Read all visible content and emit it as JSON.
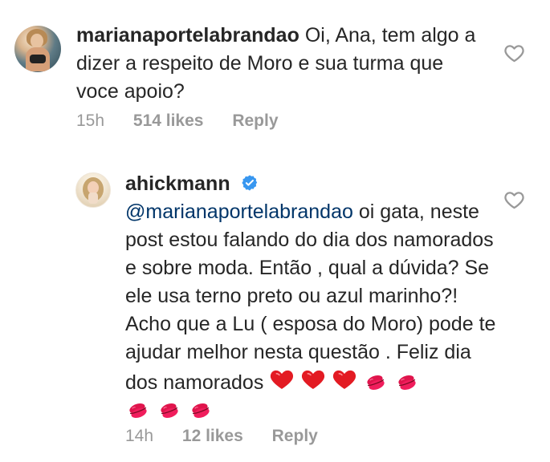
{
  "comment1": {
    "username": "marianaportelabrandao",
    "text": "Oi, Ana, tem algo a dizer a respeito de Moro e sua turma que voce apoio?",
    "time": "15h",
    "likes": "514 likes",
    "reply": "Reply"
  },
  "comment2": {
    "username": "ahickmann",
    "mention": "@marianaportelabrandao",
    "text": "oi gata, neste post estou falando do dia dos namorados e sobre moda. Então , qual a dúvida? Se ele usa terno preto ou azul marinho?! Acho que a Lu ( esposa do Moro) pode te ajudar melhor nesta questão . Feliz dia dos namorados",
    "emojis": [
      "heart",
      "heart",
      "heart",
      "kiss",
      "kiss",
      "kiss",
      "kiss",
      "kiss"
    ],
    "time": "14h",
    "likes": "12 likes",
    "reply": "Reply"
  },
  "icons": {
    "heart_outline": "heart-outline-icon",
    "verified_badge": "verified-badge-icon"
  },
  "colors": {
    "text_primary": "#262626",
    "text_secondary": "#999999",
    "mention": "#003569",
    "verified": "#3897f0"
  }
}
